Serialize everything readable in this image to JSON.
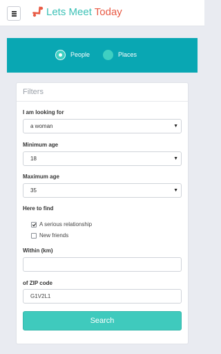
{
  "navbar": {
    "brand_part1": "Lets Meet",
    "brand_part2": "Today",
    "brand_colors": {
      "primary": "#3bc1b6",
      "accent": "#e85a44"
    }
  },
  "search_mode": {
    "options": [
      {
        "label": "People",
        "selected": true
      },
      {
        "label": "Places",
        "selected": false
      }
    ],
    "background": "#09a7b3"
  },
  "filters": {
    "title": "Filters",
    "looking_for": {
      "label": "I am looking for",
      "value": "a woman"
    },
    "min_age": {
      "label": "Minimum age",
      "value": "18"
    },
    "max_age": {
      "label": "Maximum age",
      "value": "35"
    },
    "here_to_find": {
      "label": "Here to find",
      "options": [
        {
          "label": "A serious relationship",
          "checked": true
        },
        {
          "label": "New friends",
          "checked": false
        }
      ]
    },
    "within": {
      "label": "Within (km)",
      "value": ""
    },
    "zip": {
      "label": "of ZIP code",
      "value": "G1V2L1"
    },
    "search_label": "Search"
  }
}
